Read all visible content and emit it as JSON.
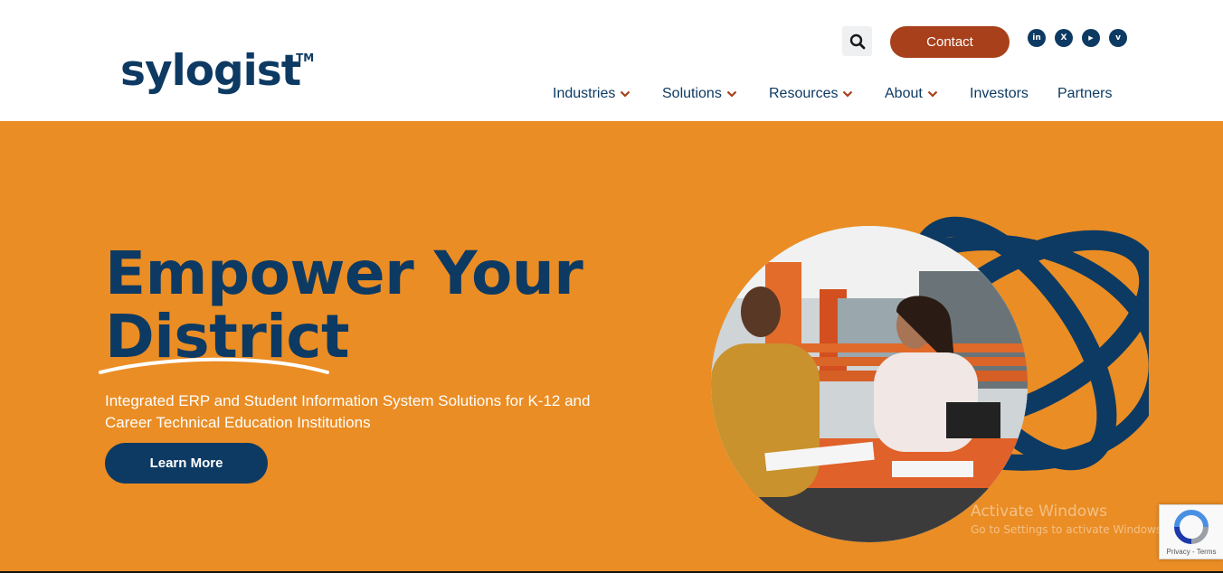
{
  "brand": {
    "name": "sylogist",
    "trademark": "TM"
  },
  "header": {
    "search_icon": "search-icon",
    "contact_label": "Contact",
    "social": [
      {
        "name": "linkedin-icon",
        "glyph": "in"
      },
      {
        "name": "x-icon",
        "glyph": "X"
      },
      {
        "name": "youtube-icon",
        "glyph": "▶"
      },
      {
        "name": "vimeo-icon",
        "glyph": "v"
      }
    ],
    "nav": [
      {
        "label": "Industries",
        "dropdown": true
      },
      {
        "label": "Solutions",
        "dropdown": true
      },
      {
        "label": "Resources",
        "dropdown": true
      },
      {
        "label": "About",
        "dropdown": true
      },
      {
        "label": "Investors",
        "dropdown": false
      },
      {
        "label": "Partners",
        "dropdown": false
      }
    ]
  },
  "hero": {
    "title_line1": "Empower Your",
    "title_line2": "District",
    "subtitle": "Integrated ERP and Student Information System Solutions for K-12 and Career Technical Education Institutions",
    "cta_label": "Learn More"
  },
  "overlay": {
    "activate_title": "Activate Windows",
    "activate_sub": "Go to Settings to activate Windows."
  },
  "recaptcha": {
    "terms": "Privacy - Terms"
  },
  "colors": {
    "navy": "#0d3a63",
    "orange": "#ea8d24",
    "rust": "#a8401b",
    "chevron": "#a8401b"
  }
}
